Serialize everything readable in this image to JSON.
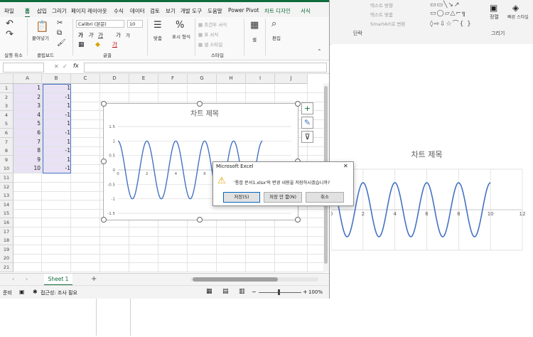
{
  "excel": {
    "tabs": [
      "파일",
      "홈",
      "삽입",
      "그리기",
      "페이지 레이아웃",
      "수식",
      "데이터",
      "검토",
      "보기",
      "개발 도구",
      "도움말",
      "Power Pivot",
      "차트 디자인",
      "서식"
    ],
    "ribbon": {
      "undo_label": "실행 취소",
      "paste_label": "붙여넣기",
      "clipboard_label": "클립보드",
      "font_name": "Calibri (본문)",
      "font_size": "10",
      "font_label": "글꼴",
      "align_label": "맞춤",
      "number_label": "표시 형식",
      "cond_format": "조건부 서식",
      "table_format": "표 서식",
      "cell_style": "셀 스타일",
      "styles_label": "스타일",
      "cells_label": "셀",
      "edit_label": "편집",
      "bold": "가",
      "italic": "가",
      "underline": "가",
      "grow_font": "가",
      "shrink_font": "가",
      "fill_color_letter": "가"
    },
    "formula_bar": {
      "fx": "fx",
      "name_box": "",
      "formula": ""
    },
    "columns": [
      "A",
      "B",
      "C",
      "D",
      "E",
      "F",
      "G",
      "H",
      "I",
      "J"
    ],
    "rows": [
      "1",
      "2",
      "3",
      "4",
      "5",
      "6",
      "7",
      "8",
      "9",
      "10",
      "11",
      "12",
      "13",
      "14",
      "15",
      "16",
      "17",
      "18",
      "19",
      "20",
      "21"
    ],
    "col_a": [
      "1",
      "2",
      "3",
      "4",
      "5",
      "6",
      "7",
      "8",
      "9",
      "10"
    ],
    "col_b": [
      "1",
      "-1",
      "1",
      "-1",
      "1",
      "-1",
      "1",
      "-1",
      "1",
      "-1"
    ],
    "sheet_tab": "Sheet 1",
    "status": {
      "ready": "준비",
      "accessibility": "접근성: 조사 필요",
      "zoom": "100%"
    }
  },
  "chart_data": {
    "type": "line",
    "title": "차트 제목",
    "x": [
      0,
      0.5,
      1,
      1.5,
      2,
      2.5,
      3,
      3.5,
      4,
      4.5,
      5,
      5.5,
      6,
      6.5,
      7,
      7.5,
      8,
      8.5,
      9,
      9.5,
      10
    ],
    "series": [
      {
        "values": [
          1,
          0,
          -1,
          0,
          1,
          0,
          -1,
          0,
          1,
          0,
          -1,
          0,
          1,
          0,
          -1,
          0,
          1,
          0,
          -1,
          0,
          1
        ]
      }
    ],
    "xlim": [
      0,
      12
    ],
    "ylim": [
      -1.5,
      1.5
    ],
    "xticks": [
      "0",
      "2",
      "4",
      "6",
      "8",
      "10",
      "12"
    ],
    "yticks": [
      "1.5",
      "1",
      "0.5",
      "0",
      "-0.5",
      "-1",
      "-1.5"
    ],
    "grid": true,
    "line_color": "#4472c4"
  },
  "dialog": {
    "title": "Microsoft Excel",
    "message": "'통합 문서1.xlsx'의 변경 내용을 저장하시겠습니까?",
    "save": "저장(S)",
    "dont_save": "저장 안 함(N)",
    "cancel": "취소",
    "close": "✕"
  },
  "background_app": {
    "menu_items": [
      "텍스트 방향",
      "텍스트 맞춤",
      "SmartArt로 변환"
    ],
    "paragraph_label": "단락",
    "draw_label": "그리기",
    "arrange_label": "정렬",
    "quick_style": "빠른 스타일",
    "slide_chart_title": "차트 제목",
    "slide_xticks": [
      "0",
      "2",
      "4",
      "6",
      "8",
      "10",
      "12"
    ]
  },
  "colors": {
    "excel_green": "#0f6b3a",
    "selection": "#e8e2f4",
    "series": "#4472c4"
  }
}
